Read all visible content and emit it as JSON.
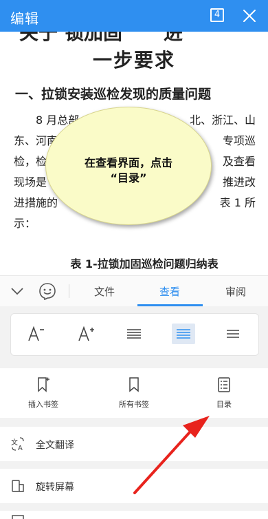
{
  "topbar": {
    "title": "编辑",
    "page_count": "4"
  },
  "document": {
    "title_fragment": "关于... 锁加固... 进",
    "title_line2": "一步要求",
    "heading": "一、拉锁安装巡检发现的质量问题",
    "para_lines": [
      {
        "left": "8 月总部",
        "right": "北、浙江、山"
      },
      {
        "left": "东、河南",
        "right": "专项巡"
      },
      {
        "left": "检，检",
        "right": "及查看"
      },
      {
        "left": "现场是",
        "right": "推进改"
      },
      {
        "left": "进措施的",
        "right": "表 1 所"
      },
      {
        "left": "示：",
        "right": ""
      }
    ],
    "table_title": "表 1-拉锁加固巡检问题归纳表"
  },
  "callout": {
    "line1": "在查看界面，点击",
    "line2": "“目录”"
  },
  "tabs": {
    "items": [
      "文件",
      "查看",
      "审阅"
    ],
    "active": "查看"
  },
  "format_buttons": [
    "decrease-font",
    "increase-font",
    "align-justify",
    "align-center",
    "align-left"
  ],
  "bookmarks": [
    {
      "label": "插入书签"
    },
    {
      "label": "所有书签"
    },
    {
      "label": "目录"
    }
  ],
  "menu_rows": [
    {
      "label": "全文翻译"
    },
    {
      "label": "旋转屏幕"
    },
    {
      "label": ""
    }
  ],
  "colors": {
    "accent": "#2f8ff0",
    "callout": "#fafbc8",
    "arrow": "#e8231d"
  }
}
